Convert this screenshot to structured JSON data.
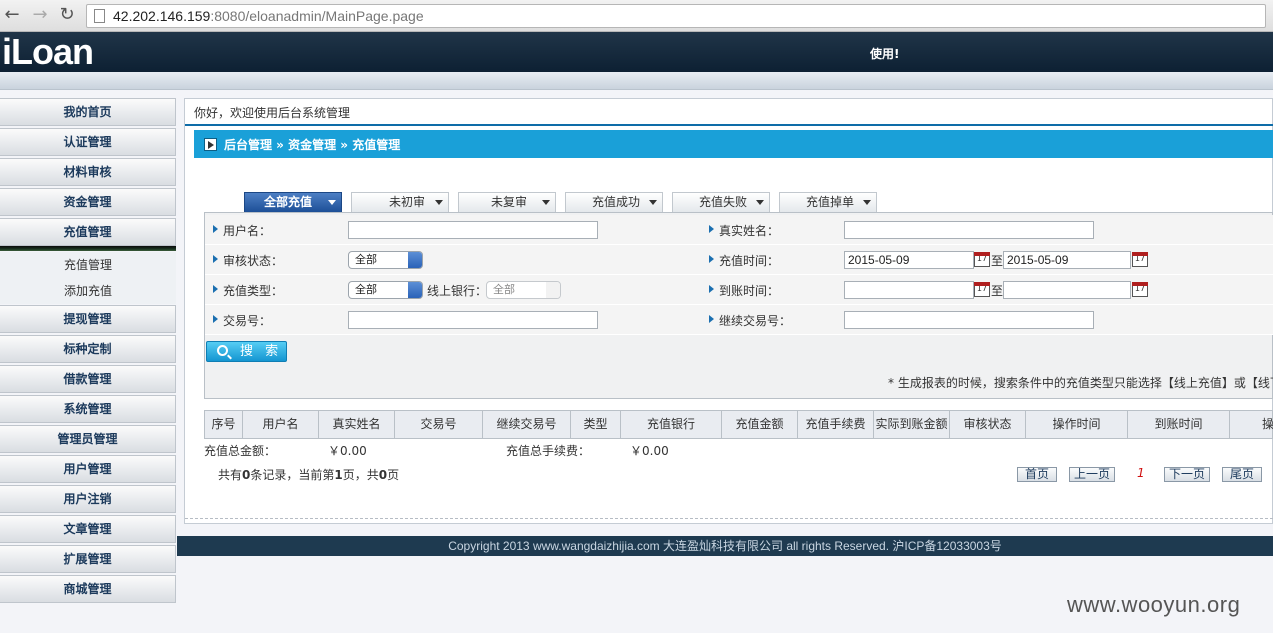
{
  "browser": {
    "url_host": "42.202.146.159",
    "url_path": ":8080/eloanadmin/MainPage.page"
  },
  "header": {
    "logo": "iLoan",
    "notice": "使用!"
  },
  "sidebar": {
    "items": [
      "我的首页",
      "认证管理",
      "材料审核",
      "资金管理",
      "充值管理"
    ],
    "sub_items": [
      "充值管理",
      "添加充值"
    ],
    "items_after": [
      "提现管理",
      "标种定制",
      "借款管理",
      "系统管理",
      "管理员管理",
      "用户管理",
      "用户注销",
      "文章管理",
      "扩展管理",
      "商城管理"
    ]
  },
  "main": {
    "welcome": "你好，欢迎使用后台系统管理",
    "breadcrumb": "后台管理 » 资金管理 » 充值管理",
    "tabs": [
      "全部充值",
      "未初审",
      "未复审",
      "充值成功",
      "充值失败",
      "充值掉单"
    ],
    "form": {
      "username_label": "用户名：",
      "realname_label": "真实姓名：",
      "status_label": "审核状态：",
      "status_value": "全部",
      "time_label": "充值时间：",
      "time_from": "2015-05-09",
      "time_to": "2015-05-09",
      "to": "至",
      "type_label": "充值类型：",
      "type_value": "全部",
      "bank_label": "线上银行：",
      "bank_value": "全部",
      "arrive_label": "到账时间：",
      "tx_label": "交易号：",
      "cont_tx_label": "继续交易号：",
      "calendar_day": "17",
      "search_button": "搜 索",
      "note": "* 生成报表的时候，搜索条件中的充值类型只能选择【线上充值】或【线下"
    },
    "table": {
      "columns": [
        "序号",
        "用户名",
        "真实姓名",
        "交易号",
        "继续交易号",
        "类型",
        "充值银行",
        "充值金额",
        "充值手续费",
        "实际到账金额",
        "审核状态",
        "操作时间",
        "到账时间",
        "操"
      ],
      "total_label": "充值总金额：",
      "total_value": "￥0.00",
      "fee_label": "充值总手续费：",
      "fee_value": "￥0.00"
    },
    "pager": {
      "info_a": "共有",
      "records": "0",
      "info_b": "条记录，当前第",
      "page": "1",
      "info_c": "页，共",
      "pages": "0",
      "info_d": "页",
      "first": "首页",
      "prev": "上一页",
      "current": "1",
      "next": "下一页",
      "last": "尾页"
    }
  },
  "footer": "Copyright 2013 www.wangdaizhijia.com 大连盈灿科技有限公司 all rights Reserved. 沪ICP备12033003号",
  "watermark": "www.wooyun.org"
}
